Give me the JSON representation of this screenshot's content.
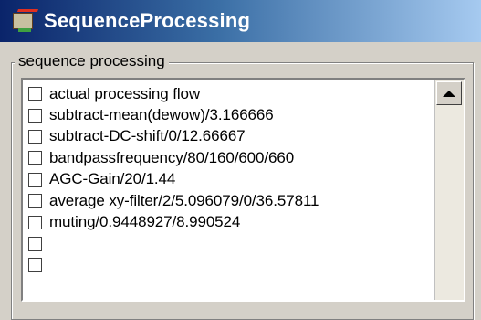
{
  "window": {
    "title": "SequenceProcessing",
    "icon": "sequence-app-icon"
  },
  "group": {
    "label": "sequence processing"
  },
  "list": {
    "items": [
      {
        "label": "actual processing flow",
        "checked": false
      },
      {
        "label": "subtract-mean(dewow)/3.166666",
        "checked": false
      },
      {
        "label": "subtract-DC-shift/0/12.66667",
        "checked": false
      },
      {
        "label": "bandpassfrequency/80/160/600/660",
        "checked": false
      },
      {
        "label": "AGC-Gain/20/1.44",
        "checked": false
      },
      {
        "label": "average xy-filter/2/5.096079/0/36.57811",
        "checked": false
      },
      {
        "label": "muting/0.9448927/8.990524",
        "checked": false
      },
      {
        "label": "",
        "checked": false
      },
      {
        "label": "",
        "checked": false
      }
    ]
  },
  "scrollbar": {
    "up_icon": "triangle-up-icon"
  }
}
